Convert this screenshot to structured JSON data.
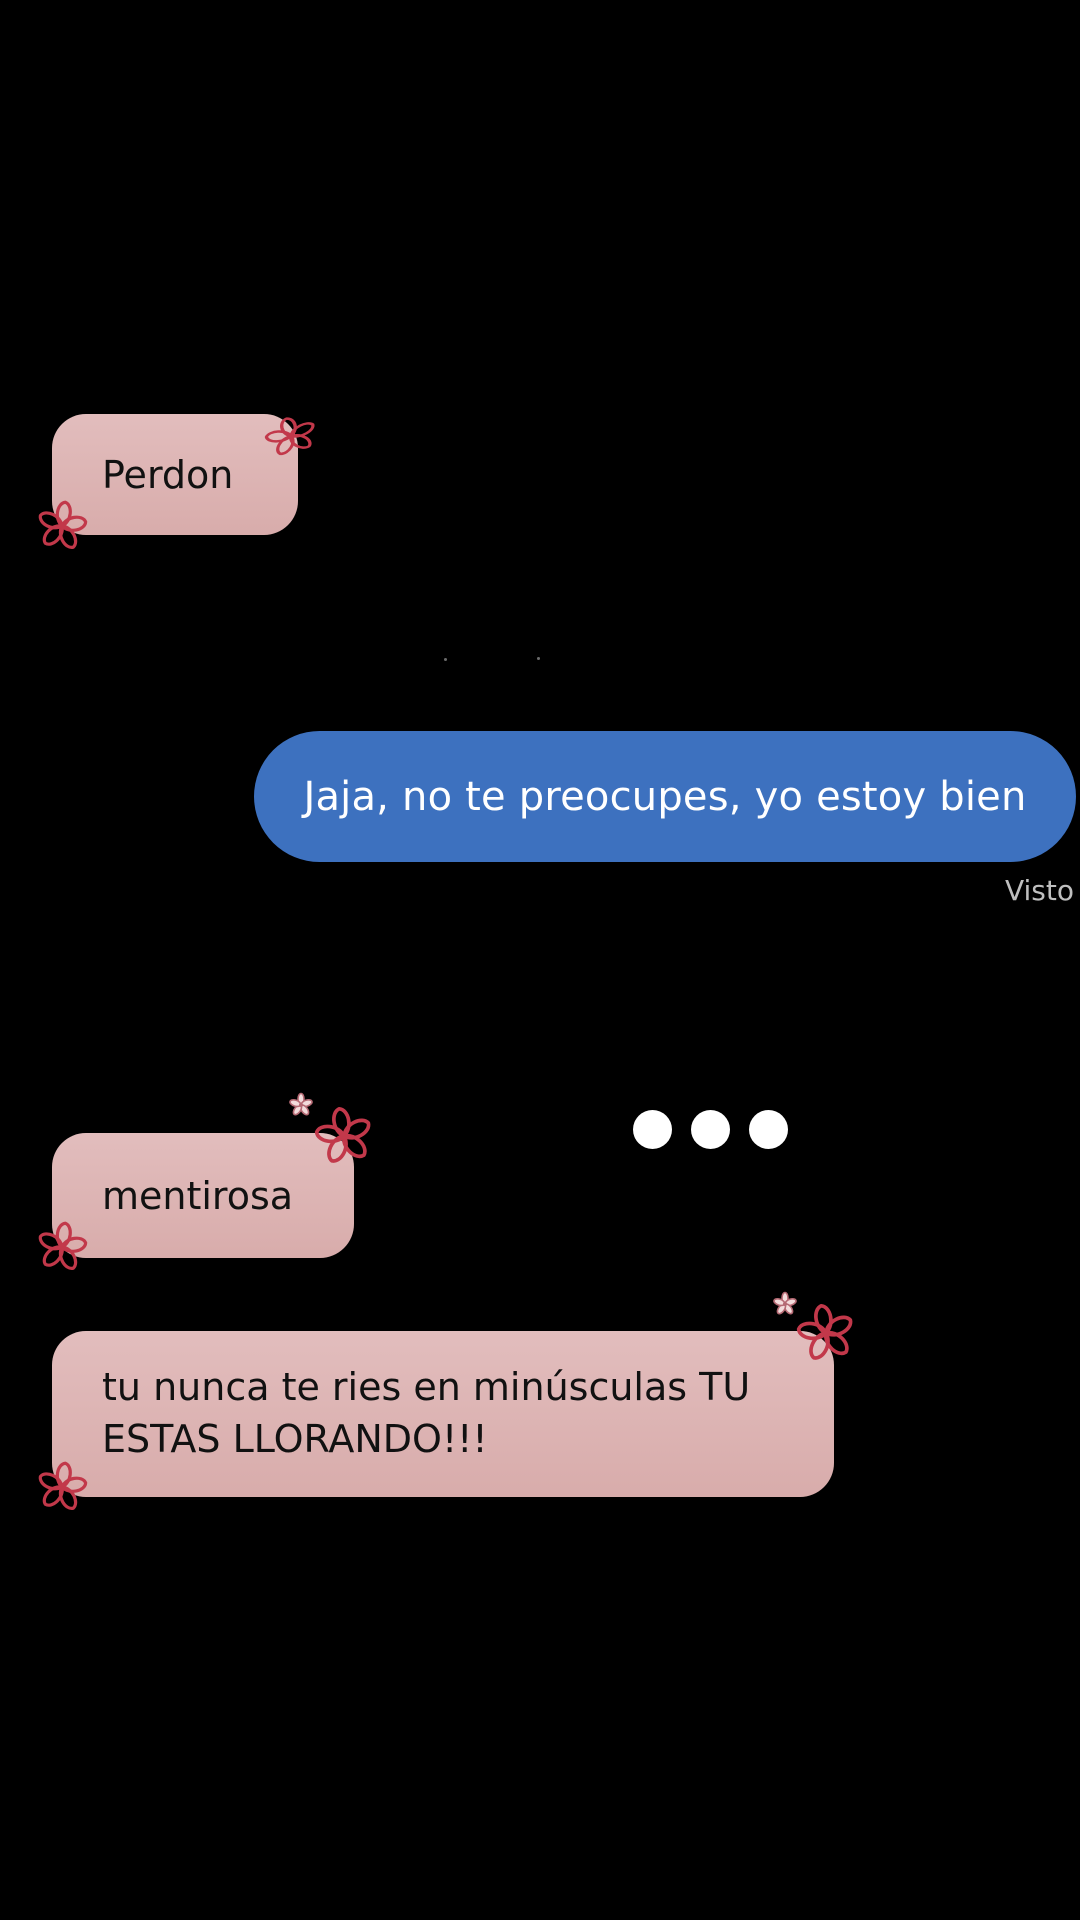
{
  "conversation": {
    "messages": [
      {
        "direction": "incoming",
        "text": "Perdon"
      },
      {
        "direction": "outgoing",
        "text": "Jaja, no te preocupes, yo estoy bien"
      },
      {
        "direction": "incoming",
        "text": "mentirosa"
      },
      {
        "direction": "incoming",
        "text": "tu nunca te ries en minúsculas TU ESTAS LLORANDO!!!"
      }
    ],
    "read_receipt": "Visto",
    "typing_indicator": {
      "visible": true,
      "dots": 3
    }
  },
  "colors": {
    "background": "#000000",
    "incoming_bubble": "#e0baba",
    "outgoing_bubble": "#3d71bf",
    "flower_outline": "#c2384a",
    "receipt_text": "#bfbfbf"
  },
  "decorations": {
    "icon": "flower-doodle-icon"
  }
}
